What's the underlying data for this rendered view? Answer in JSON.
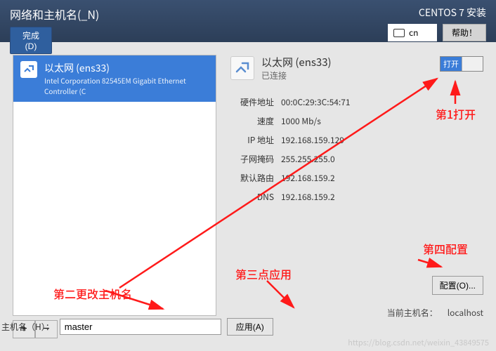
{
  "header": {
    "title": "网络和主机名(_N)",
    "done_label": "完成(D)",
    "install_title": "CENTOS 7 安装",
    "keyboard": "cn",
    "help_label": "帮助！"
  },
  "iface": {
    "name": "以太网 (ens33)",
    "desc": "Intel Corporation 82545EM Gigabit Ethernet Controller (C"
  },
  "list_buttons": {
    "add": "+",
    "remove": "−"
  },
  "detail": {
    "title": "以太网 (ens33)",
    "status": "已连接",
    "toggle_on": "打开",
    "rows": [
      {
        "label": "硬件地址",
        "value": "00:0C:29:3C:54:71"
      },
      {
        "label": "速度",
        "value": "1000 Mb/s"
      },
      {
        "label": "IP 地址",
        "value": "192.168.159.129"
      },
      {
        "label": "子网掩码",
        "value": "255.255.255.0"
      },
      {
        "label": "默认路由",
        "value": "192.168.159.2"
      },
      {
        "label": "DNS",
        "value": "192.168.159.2"
      }
    ]
  },
  "configure_label": "配置(O)...",
  "hostname": {
    "label": "主机名（H）：",
    "value": "master",
    "apply_label": "应用(A)",
    "current_label": "当前主机名：",
    "current_value": "localhost"
  },
  "annotations": {
    "a1": "第1打开",
    "a2": "第二更改主机名",
    "a3": "第三点应用",
    "a4": "第四配置"
  },
  "watermark": "https://blog.csdn.net/weixin_43849575"
}
